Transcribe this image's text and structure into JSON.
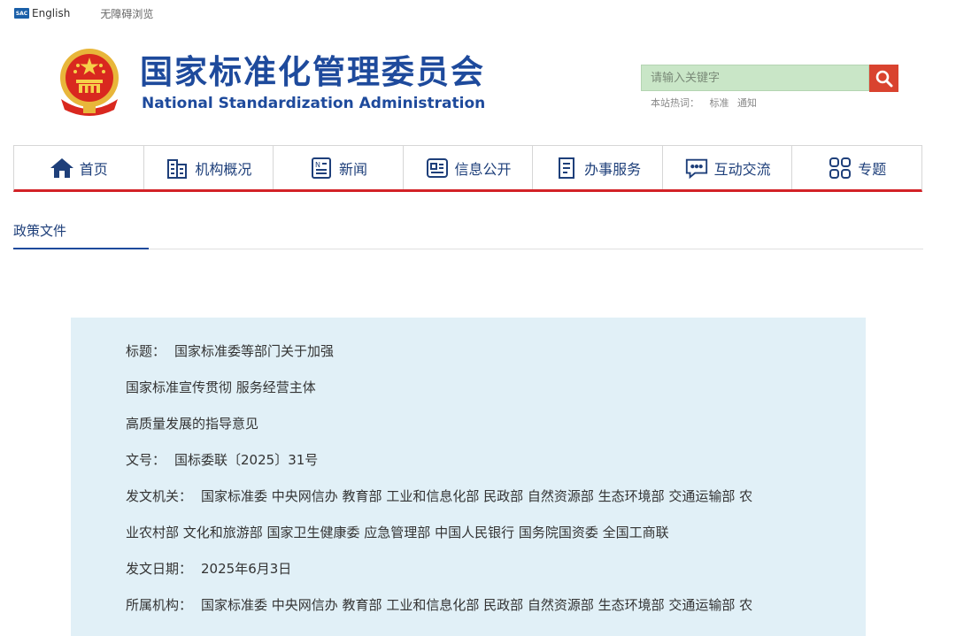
{
  "topbar": {
    "english_label": "English",
    "english_icon": "globe-icon",
    "accessibility_label": "无障碍浏览"
  },
  "header": {
    "title_cn": "国家标准化管理委员会",
    "title_en": "National Standardization Administration",
    "emblem": "national-emblem"
  },
  "search": {
    "placeholder": "请输入关键字",
    "hot_label": "本站热词：",
    "hot_words": [
      "标准",
      "通知"
    ]
  },
  "nav": {
    "items": [
      {
        "label": "首页",
        "icon": "home-icon"
      },
      {
        "label": "机构概况",
        "icon": "building-icon"
      },
      {
        "label": "新闻",
        "icon": "news-icon"
      },
      {
        "label": "信息公开",
        "icon": "info-icon"
      },
      {
        "label": "办事服务",
        "icon": "form-icon"
      },
      {
        "label": "互动交流",
        "icon": "chat-icon"
      },
      {
        "label": "专题",
        "icon": "grid-icon"
      }
    ]
  },
  "section": {
    "tab_label": "政策文件"
  },
  "document": {
    "title_label": "标题：",
    "title_line1": "国家标准委等部门关于加强",
    "title_line2": "国家标准宣传贯彻 服务经营主体",
    "title_line3": "高质量发展的指导意见",
    "number_label": "文号：",
    "number_value": "国标委联〔2025〕31号",
    "issuer_label": "发文机关：",
    "issuer_line1": "国家标准委 中央网信办 教育部 工业和信息化部 民政部 自然资源部 生态环境部 交通运输部 农",
    "issuer_line2": "业农村部 文化和旅游部 国家卫生健康委 应急管理部 中国人民银行 国务院国资委 全国工商联",
    "date_label": "发文日期：",
    "date_value": "2025年6月3日",
    "org_label": "所属机构：",
    "org_line1": "国家标准委 中央网信办 教育部 工业和信息化部 民政部 自然资源部 生态环境部 交通运输部 农"
  },
  "colors": {
    "brand_blue": "#1e4a9c",
    "accent_red": "#d32227",
    "search_bg": "#c9e6c7",
    "panel_bg": "#e1f0f7"
  }
}
